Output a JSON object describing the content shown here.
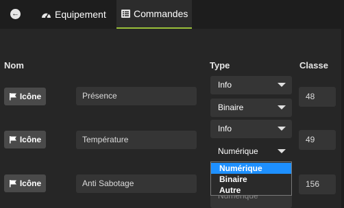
{
  "tabs": {
    "equipement": "Equipement",
    "commandes": "Commandes"
  },
  "headers": {
    "nom": "Nom",
    "type": "Type",
    "classe": "Classe"
  },
  "rows": [
    {
      "icon_label": "Icône",
      "name": "Présence",
      "type": "Info",
      "subtype": "Binaire",
      "classe": "48"
    },
    {
      "icon_label": "Icône",
      "name": "Température",
      "type": "Info",
      "subtype": "Numérique",
      "classe": "49"
    },
    {
      "icon_label": "Icône",
      "name": "Anti Sabotage",
      "type": "",
      "subtype": "Numérique",
      "classe": "156"
    }
  ],
  "dropdown": {
    "options": [
      "Numérique",
      "Binaire",
      "Autre"
    ],
    "selected": "Numérique"
  },
  "colors": {
    "accent": "#9bc23a",
    "selected_option": "#1e90ff",
    "background": "#262626",
    "topbar": "#1d1d1d"
  }
}
